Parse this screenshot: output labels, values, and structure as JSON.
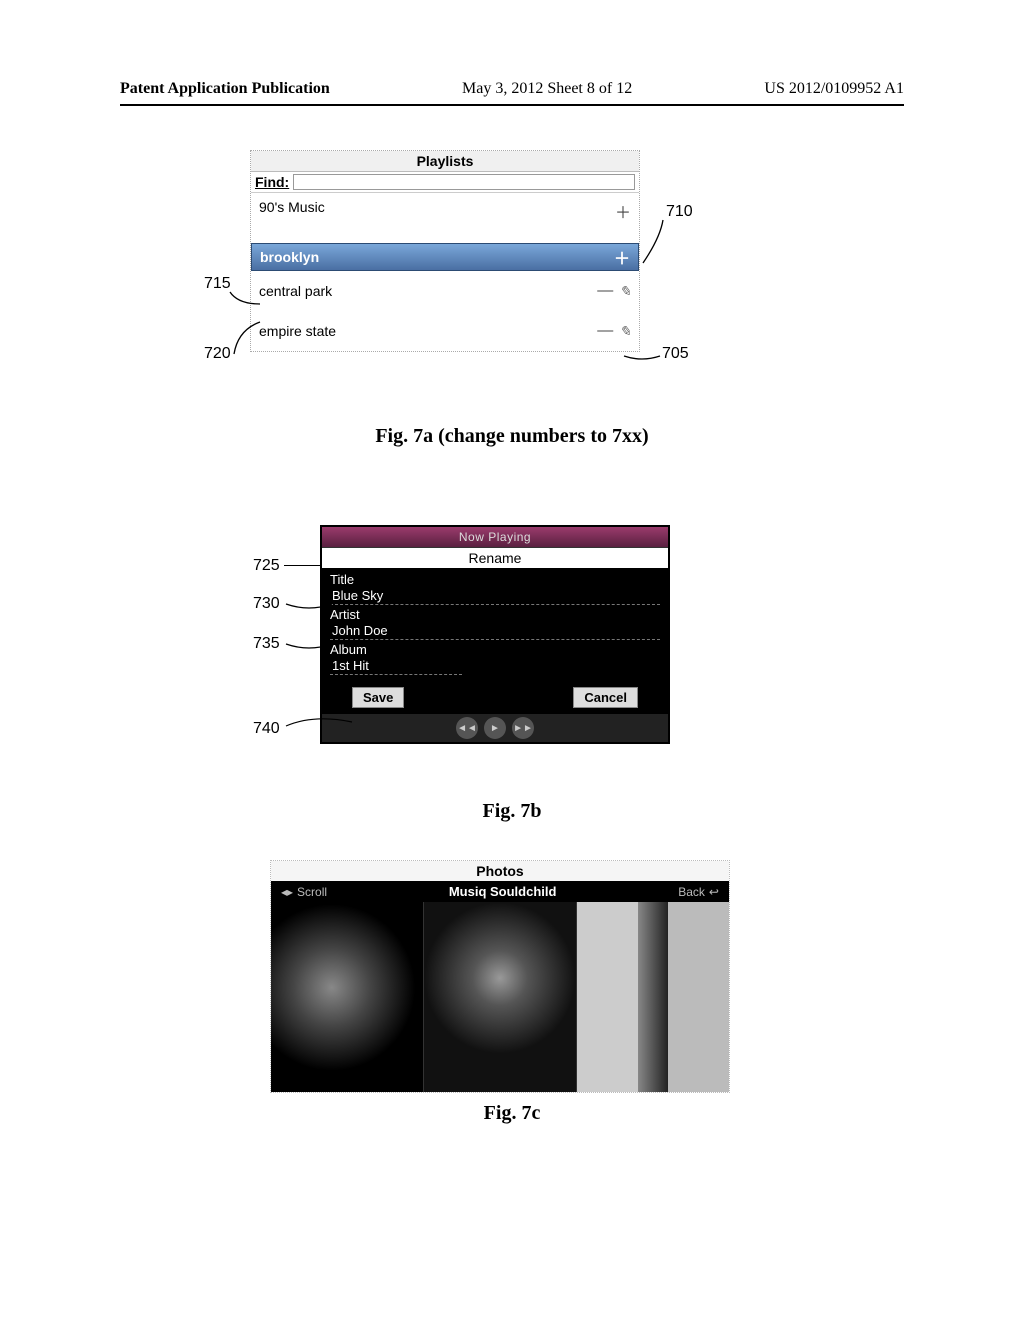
{
  "header": {
    "left": "Patent Application Publication",
    "mid": "May 3, 2012  Sheet 8 of 12",
    "right": "US 2012/0109952 A1"
  },
  "fig7a": {
    "title": "Playlists",
    "find_label": "Find:",
    "find_value": "",
    "items": [
      {
        "label": "90's Music",
        "selected": false,
        "plus": true,
        "minus": false,
        "edit": false
      },
      {
        "label": "brooklyn",
        "selected": true,
        "plus": true,
        "minus": false,
        "edit": false
      },
      {
        "label": "central park",
        "selected": false,
        "plus": false,
        "minus": true,
        "edit": true
      },
      {
        "label": "empire state",
        "selected": false,
        "plus": false,
        "minus": true,
        "edit": true
      }
    ],
    "callouts": {
      "710": "710",
      "715": "715",
      "720": "720",
      "705": "705"
    },
    "caption": "Fig. 7a (change numbers to 7xx)"
  },
  "fig7b": {
    "top_banner": "Now Playing",
    "rename": "Rename",
    "title_label": "Title",
    "title_value": "Blue Sky",
    "artist_label": "Artist",
    "artist_value": "John Doe",
    "album_label": "Album",
    "album_value": "1st Hit",
    "save": "Save",
    "cancel": "Cancel",
    "callouts": {
      "725": "725",
      "730": "730",
      "735": "735",
      "740": "740"
    },
    "caption": "Fig. 7b"
  },
  "fig7c": {
    "title": "Photos",
    "bar_left": "Scroll",
    "bar_mid": "Musiq Souldchild",
    "bar_right": "Back",
    "caption": "Fig. 7c"
  }
}
